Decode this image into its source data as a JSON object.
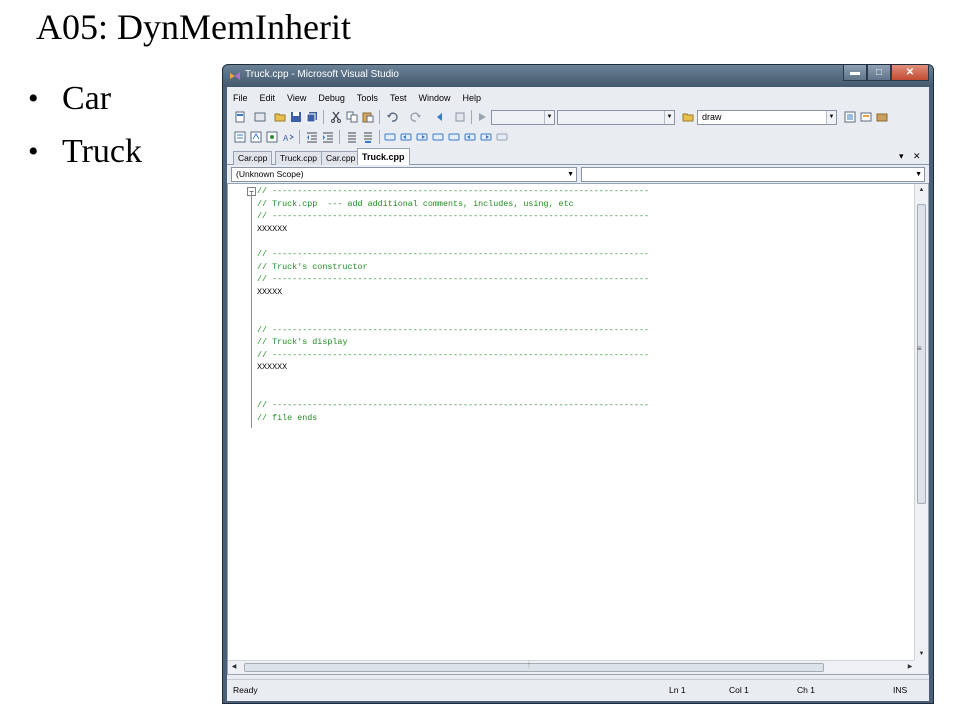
{
  "slide": {
    "title": "A05: DynMemInherit",
    "bullets": [
      "Car",
      "Truck"
    ]
  },
  "window": {
    "title": "Truck.cpp - Microsoft Visual Studio",
    "controls": {
      "minimize": "▬",
      "maximize": "□",
      "close": "✕"
    }
  },
  "menubar": [
    "File",
    "Edit",
    "View",
    "Debug",
    "Tools",
    "Test",
    "Window",
    "Help"
  ],
  "toolbar": {
    "find_combo_value": "draw"
  },
  "tabs": [
    {
      "label": "Car.cpp",
      "active": false
    },
    {
      "label": "Truck.cpp",
      "active": false
    },
    {
      "label": "Car.cpp",
      "active": false
    },
    {
      "label": "Truck.cpp",
      "active": true
    }
  ],
  "tabstrip_controls": {
    "dropdown": "▾",
    "close": "✕"
  },
  "scope": {
    "left": "(Unknown Scope)",
    "right": ""
  },
  "code_lines": [
    {
      "text": "// ---------------------------------------------------------------------------",
      "kind": "cmt"
    },
    {
      "text": "// Truck.cpp  --- add additional comments, includes, using, etc",
      "kind": "cmt"
    },
    {
      "text": "// ---------------------------------------------------------------------------",
      "kind": "cmt"
    },
    {
      "text": "XXXXXX",
      "kind": "txt"
    },
    {
      "text": "",
      "kind": "txt"
    },
    {
      "text": "// ---------------------------------------------------------------------------",
      "kind": "cmt"
    },
    {
      "text": "// Truck's constructor",
      "kind": "cmt"
    },
    {
      "text": "// ---------------------------------------------------------------------------",
      "kind": "cmt"
    },
    {
      "text": "XXXXX",
      "kind": "txt"
    },
    {
      "text": "",
      "kind": "txt"
    },
    {
      "text": "",
      "kind": "txt"
    },
    {
      "text": "// ---------------------------------------------------------------------------",
      "kind": "cmt"
    },
    {
      "text": "// Truck's display",
      "kind": "cmt"
    },
    {
      "text": "// ---------------------------------------------------------------------------",
      "kind": "cmt"
    },
    {
      "text": "XXXXXX",
      "kind": "txt"
    },
    {
      "text": "",
      "kind": "txt"
    },
    {
      "text": "",
      "kind": "txt"
    },
    {
      "text": "// ---------------------------------------------------------------------------",
      "kind": "cmt"
    },
    {
      "text": "// file ends",
      "kind": "cmt"
    }
  ],
  "collapse_glyph": "−",
  "statusbar": {
    "state": "Ready",
    "line": "Ln 1",
    "col": "Col 1",
    "ch": "Ch 1",
    "mode": "INS"
  },
  "colors": {
    "comment": "#228b22",
    "titlebar": "#4a6078",
    "chrome": "#e9edf2"
  }
}
